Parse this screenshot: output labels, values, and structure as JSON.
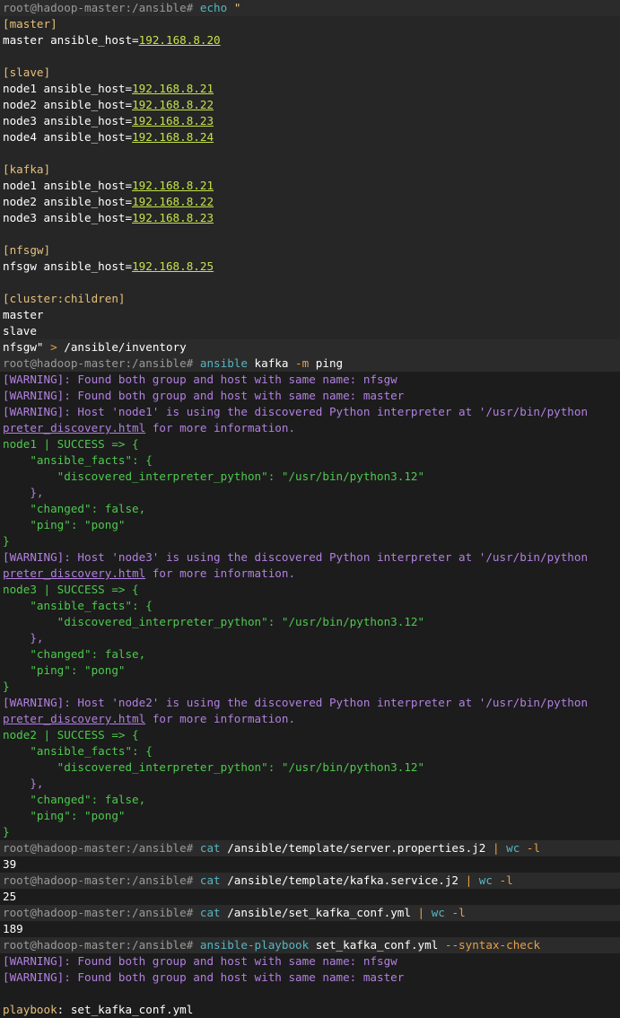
{
  "terminal": {
    "colors": {
      "background": "#1c1c1c",
      "prompt_bg": "#2b2b2b",
      "text": "#ffffff",
      "muted": "#9a9a9a",
      "green": "#4ec94e",
      "yellow": "#e5c07b",
      "cyan": "#56b6c2",
      "purple": "#b180e0",
      "ip": "#c5e24b",
      "orange": "#e5a04a",
      "key": "#e5c07b"
    },
    "prompt": "root@hadoop-master:/ansible#",
    "lines": [
      {
        "kind": "prompt",
        "segs": [
          {
            "t": "root@hadoop-master:/ansible# ",
            "c": "muted"
          },
          {
            "t": "echo",
            "c": "cyan"
          },
          {
            "t": " \"",
            "c": "yellow"
          }
        ]
      },
      {
        "kind": "hl",
        "segs": [
          {
            "t": "[master]",
            "c": "yellow"
          }
        ]
      },
      {
        "kind": "hl",
        "segs": [
          {
            "t": "master ansible_host=",
            "c": "text"
          },
          {
            "t": "192.168.8.20",
            "c": "ip",
            "u": true
          }
        ]
      },
      {
        "kind": "hl",
        "segs": []
      },
      {
        "kind": "hl",
        "segs": [
          {
            "t": "[slave]",
            "c": "yellow"
          }
        ]
      },
      {
        "kind": "hl",
        "segs": [
          {
            "t": "node1 ansible_host=",
            "c": "text"
          },
          {
            "t": "192.168.8.21",
            "c": "ip",
            "u": true
          }
        ]
      },
      {
        "kind": "hl",
        "segs": [
          {
            "t": "node2 ansible_host=",
            "c": "text"
          },
          {
            "t": "192.168.8.22",
            "c": "ip",
            "u": true
          }
        ]
      },
      {
        "kind": "hl",
        "segs": [
          {
            "t": "node3 ansible_host=",
            "c": "text"
          },
          {
            "t": "192.168.8.23",
            "c": "ip",
            "u": true
          }
        ]
      },
      {
        "kind": "hl",
        "segs": [
          {
            "t": "node4 ansible_host=",
            "c": "text"
          },
          {
            "t": "192.168.8.24",
            "c": "ip",
            "u": true
          }
        ]
      },
      {
        "kind": "hl",
        "segs": []
      },
      {
        "kind": "hl",
        "segs": [
          {
            "t": "[kafka]",
            "c": "yellow"
          }
        ]
      },
      {
        "kind": "hl",
        "segs": [
          {
            "t": "node1 ansible_host=",
            "c": "text"
          },
          {
            "t": "192.168.8.21",
            "c": "ip",
            "u": true
          }
        ]
      },
      {
        "kind": "hl",
        "segs": [
          {
            "t": "node2 ansible_host=",
            "c": "text"
          },
          {
            "t": "192.168.8.22",
            "c": "ip",
            "u": true
          }
        ]
      },
      {
        "kind": "hl",
        "segs": [
          {
            "t": "node3 ansible_host=",
            "c": "text"
          },
          {
            "t": "192.168.8.23",
            "c": "ip",
            "u": true
          }
        ]
      },
      {
        "kind": "hl",
        "segs": []
      },
      {
        "kind": "hl",
        "segs": [
          {
            "t": "[nfsgw]",
            "c": "yellow"
          }
        ]
      },
      {
        "kind": "hl",
        "segs": [
          {
            "t": "nfsgw ansible_host=",
            "c": "text"
          },
          {
            "t": "192.168.8.25",
            "c": "ip",
            "u": true
          }
        ]
      },
      {
        "kind": "hl",
        "segs": []
      },
      {
        "kind": "hl",
        "segs": [
          {
            "t": "[cluster:children]",
            "c": "yellow"
          }
        ]
      },
      {
        "kind": "hl",
        "segs": [
          {
            "t": "master",
            "c": "text"
          }
        ]
      },
      {
        "kind": "hl",
        "segs": [
          {
            "t": "slave",
            "c": "text"
          }
        ]
      },
      {
        "kind": "prompt",
        "segs": [
          {
            "t": "nfsgw\"",
            "c": "text"
          },
          {
            "t": " > ",
            "c": "orange"
          },
          {
            "t": "/ansible/inventory",
            "c": "text"
          }
        ]
      },
      {
        "kind": "prompt",
        "segs": [
          {
            "t": "root@hadoop-master:/ansible# ",
            "c": "muted"
          },
          {
            "t": "ansible",
            "c": "cyan"
          },
          {
            "t": " kafka ",
            "c": "text"
          },
          {
            "t": "-m",
            "c": "orange"
          },
          {
            "t": " ping",
            "c": "text"
          }
        ]
      },
      {
        "kind": "out",
        "segs": [
          {
            "t": "[WARNING]: Found both group and host with same name: nfsgw",
            "c": "purple"
          }
        ]
      },
      {
        "kind": "out",
        "segs": [
          {
            "t": "[WARNING]: Found both group and host with same name: master",
            "c": "purple"
          }
        ]
      },
      {
        "kind": "out",
        "segs": [
          {
            "t": "[WARNING]: Host 'node1' is using the discovered Python interpreter at '/usr/bin/python",
            "c": "purple"
          }
        ]
      },
      {
        "kind": "out",
        "segs": [
          {
            "t": "preter_discovery.html",
            "c": "purple",
            "u": true
          },
          {
            "t": " for more information.",
            "c": "purple"
          }
        ]
      },
      {
        "kind": "out",
        "segs": [
          {
            "t": "node1 | SUCCESS => {",
            "c": "green"
          }
        ]
      },
      {
        "kind": "out",
        "segs": [
          {
            "t": "    \"ansible_facts\": {",
            "c": "green"
          }
        ]
      },
      {
        "kind": "out",
        "segs": [
          {
            "t": "        \"discovered_interpreter_python\": \"/usr/bin/python3.12\"",
            "c": "green"
          }
        ]
      },
      {
        "kind": "out",
        "segs": [
          {
            "t": "    },",
            "c": "purple"
          }
        ]
      },
      {
        "kind": "out",
        "segs": [
          {
            "t": "    \"changed\": false,",
            "c": "green"
          }
        ]
      },
      {
        "kind": "out",
        "segs": [
          {
            "t": "    \"ping\": \"pong\"",
            "c": "green"
          }
        ]
      },
      {
        "kind": "out",
        "segs": [
          {
            "t": "}",
            "c": "green"
          }
        ]
      },
      {
        "kind": "out",
        "segs": [
          {
            "t": "[WARNING]: Host 'node3' is using the discovered Python interpreter at '/usr/bin/python",
            "c": "purple"
          }
        ]
      },
      {
        "kind": "out",
        "segs": [
          {
            "t": "preter_discovery.html",
            "c": "purple",
            "u": true
          },
          {
            "t": " for more information.",
            "c": "purple"
          }
        ]
      },
      {
        "kind": "out",
        "segs": [
          {
            "t": "node3 | SUCCESS => {",
            "c": "green"
          }
        ]
      },
      {
        "kind": "out",
        "segs": [
          {
            "t": "    \"ansible_facts\": {",
            "c": "green"
          }
        ]
      },
      {
        "kind": "out",
        "segs": [
          {
            "t": "        \"discovered_interpreter_python\": \"/usr/bin/python3.12\"",
            "c": "green"
          }
        ]
      },
      {
        "kind": "out",
        "segs": [
          {
            "t": "    },",
            "c": "purple"
          }
        ]
      },
      {
        "kind": "out",
        "segs": [
          {
            "t": "    \"changed\": false,",
            "c": "green"
          }
        ]
      },
      {
        "kind": "out",
        "segs": [
          {
            "t": "    \"ping\": \"pong\"",
            "c": "green"
          }
        ]
      },
      {
        "kind": "out",
        "segs": [
          {
            "t": "}",
            "c": "green"
          }
        ]
      },
      {
        "kind": "out",
        "segs": [
          {
            "t": "[WARNING]: Host 'node2' is using the discovered Python interpreter at '/usr/bin/python",
            "c": "purple"
          }
        ]
      },
      {
        "kind": "out",
        "segs": [
          {
            "t": "preter_discovery.html",
            "c": "purple",
            "u": true
          },
          {
            "t": " for more information.",
            "c": "purple"
          }
        ]
      },
      {
        "kind": "out",
        "segs": [
          {
            "t": "node2 | SUCCESS => {",
            "c": "green"
          }
        ]
      },
      {
        "kind": "out",
        "segs": [
          {
            "t": "    \"ansible_facts\": {",
            "c": "green"
          }
        ]
      },
      {
        "kind": "out",
        "segs": [
          {
            "t": "        \"discovered_interpreter_python\": \"/usr/bin/python3.12\"",
            "c": "green"
          }
        ]
      },
      {
        "kind": "out",
        "segs": [
          {
            "t": "    },",
            "c": "purple"
          }
        ]
      },
      {
        "kind": "out",
        "segs": [
          {
            "t": "    \"changed\": false,",
            "c": "green"
          }
        ]
      },
      {
        "kind": "out",
        "segs": [
          {
            "t": "    \"ping\": \"pong\"",
            "c": "green"
          }
        ]
      },
      {
        "kind": "out",
        "segs": [
          {
            "t": "}",
            "c": "green"
          }
        ]
      },
      {
        "kind": "prompt",
        "segs": [
          {
            "t": "root@hadoop-master:/ansible# ",
            "c": "muted"
          },
          {
            "t": "cat",
            "c": "cyan"
          },
          {
            "t": " /ansible/template/server.properties.j2 ",
            "c": "text"
          },
          {
            "t": "|",
            "c": "orange"
          },
          {
            "t": " ",
            "c": "text"
          },
          {
            "t": "wc",
            "c": "cyan"
          },
          {
            "t": " ",
            "c": "text"
          },
          {
            "t": "-l",
            "c": "orange"
          }
        ]
      },
      {
        "kind": "out",
        "segs": [
          {
            "t": "39",
            "c": "text"
          }
        ]
      },
      {
        "kind": "prompt",
        "segs": [
          {
            "t": "root@hadoop-master:/ansible# ",
            "c": "muted"
          },
          {
            "t": "cat",
            "c": "cyan"
          },
          {
            "t": " /ansible/template/kafka.service.j2 ",
            "c": "text"
          },
          {
            "t": "|",
            "c": "orange"
          },
          {
            "t": " ",
            "c": "text"
          },
          {
            "t": "wc",
            "c": "cyan"
          },
          {
            "t": " ",
            "c": "text"
          },
          {
            "t": "-l",
            "c": "orange"
          }
        ]
      },
      {
        "kind": "out",
        "segs": [
          {
            "t": "25",
            "c": "text"
          }
        ]
      },
      {
        "kind": "prompt",
        "segs": [
          {
            "t": "root@hadoop-master:/ansible# ",
            "c": "muted"
          },
          {
            "t": "cat",
            "c": "cyan"
          },
          {
            "t": " /ansible/set_kafka_conf.yml ",
            "c": "text"
          },
          {
            "t": "|",
            "c": "orange"
          },
          {
            "t": " ",
            "c": "text"
          },
          {
            "t": "wc",
            "c": "cyan"
          },
          {
            "t": " ",
            "c": "text"
          },
          {
            "t": "-l",
            "c": "orange"
          }
        ]
      },
      {
        "kind": "out",
        "segs": [
          {
            "t": "189",
            "c": "text"
          }
        ]
      },
      {
        "kind": "prompt",
        "segs": [
          {
            "t": "root@hadoop-master:/ansible# ",
            "c": "muted"
          },
          {
            "t": "ansible-playbook",
            "c": "cyan"
          },
          {
            "t": " set_kafka_conf.yml ",
            "c": "text"
          },
          {
            "t": "--syntax-check",
            "c": "orange"
          }
        ]
      },
      {
        "kind": "out",
        "segs": [
          {
            "t": "[WARNING]: Found both group and host with same name: nfsgw",
            "c": "purple"
          }
        ]
      },
      {
        "kind": "out",
        "segs": [
          {
            "t": "[WARNING]: Found both group and host with same name: master",
            "c": "purple"
          }
        ]
      },
      {
        "kind": "out",
        "segs": []
      },
      {
        "kind": "out",
        "segs": [
          {
            "t": "playbook",
            "c": "key"
          },
          {
            "t": ": set_kafka_conf.yml",
            "c": "text"
          }
        ]
      }
    ]
  }
}
